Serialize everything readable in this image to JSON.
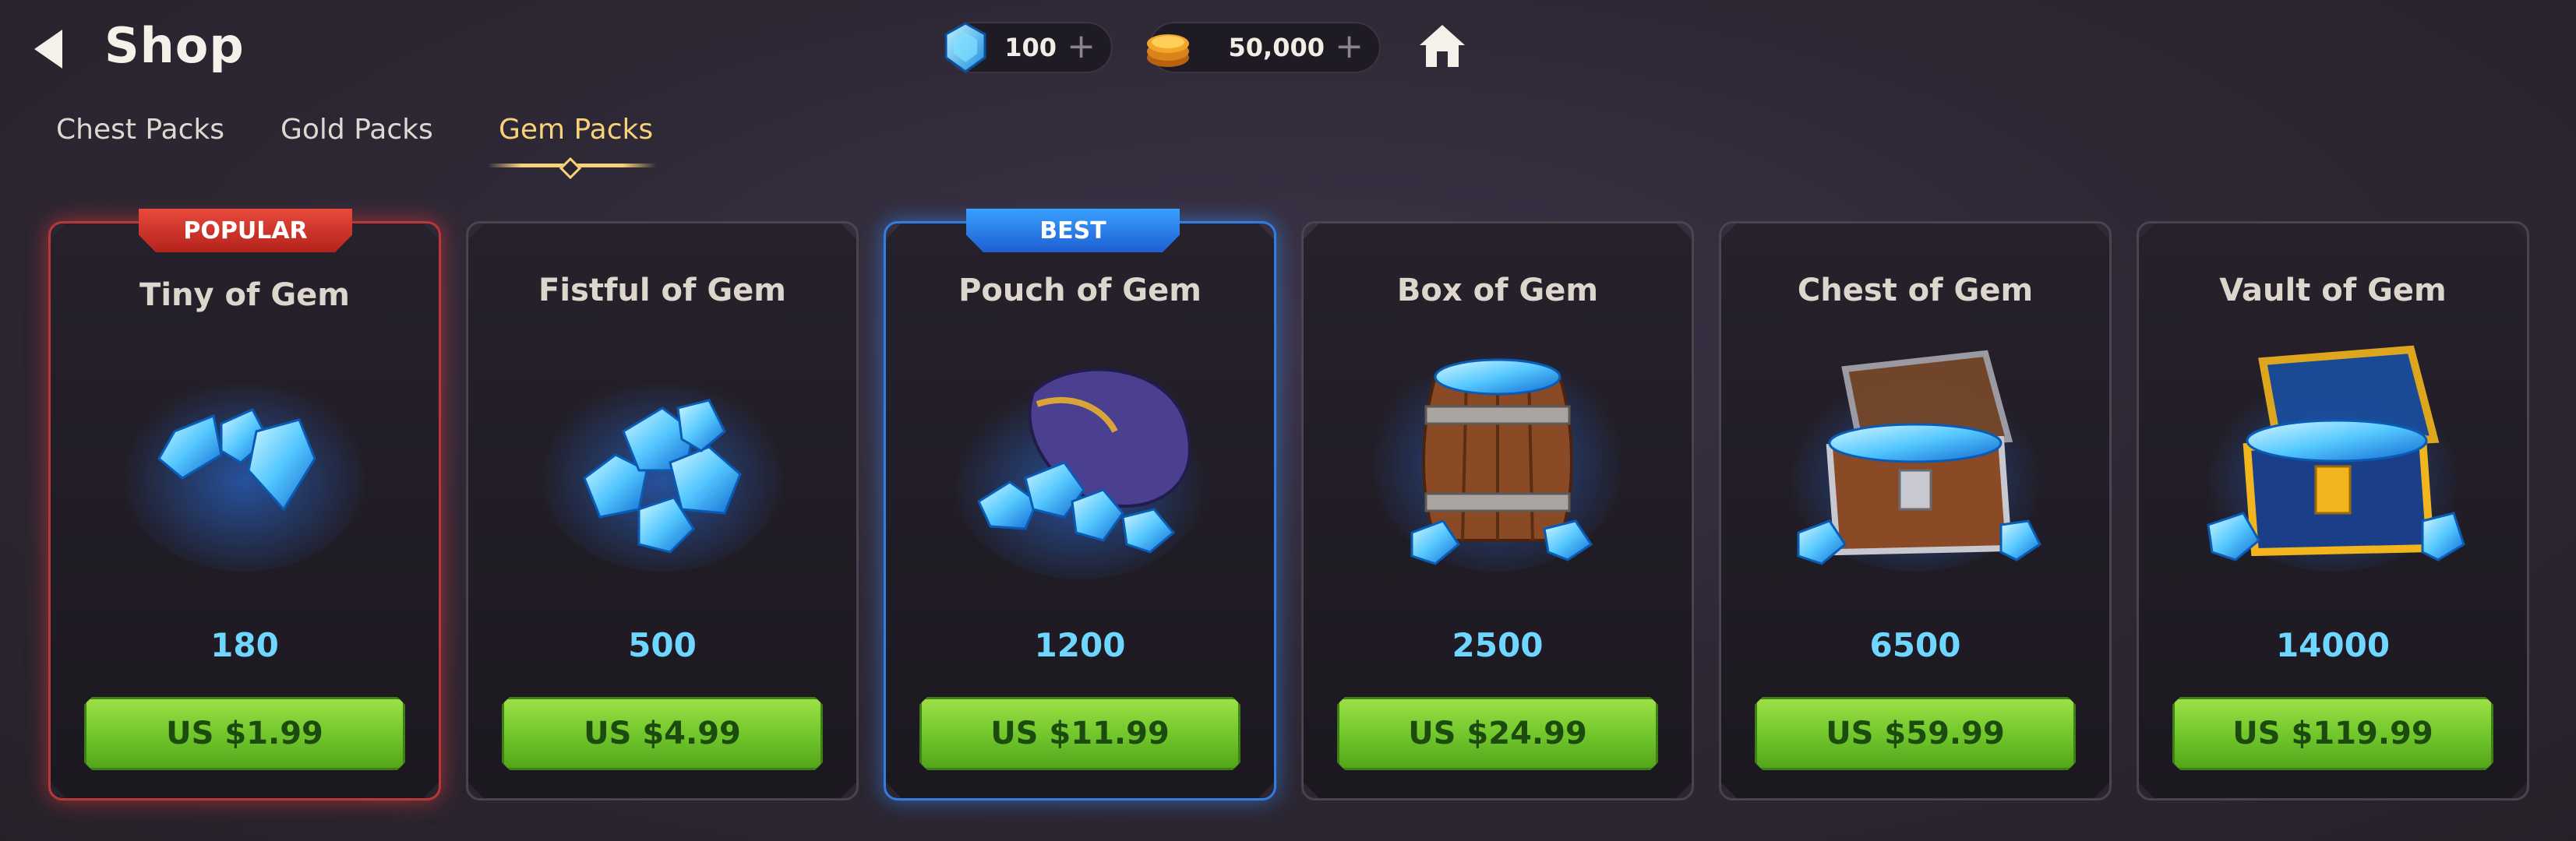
{
  "header": {
    "title": "Shop",
    "gems": "100",
    "gold": "50,000",
    "plus": "+"
  },
  "tabs": [
    "Chest Packs",
    "Gold Packs",
    "Gem Packs"
  ],
  "active_tab": "Gem Packs",
  "cards": [
    {
      "title": "Tiny of Gem",
      "amount": "180",
      "price": "US $1.99",
      "badge": "POPULAR"
    },
    {
      "title": "Fistful of Gem",
      "amount": "500",
      "price": "US $4.99",
      "badge": ""
    },
    {
      "title": "Pouch of Gem",
      "amount": "1200",
      "price": "US $11.99",
      "badge": "BEST"
    },
    {
      "title": "Box of Gem",
      "amount": "2500",
      "price": "US $24.99",
      "badge": ""
    },
    {
      "title": "Chest of Gem",
      "amount": "6500",
      "price": "US $59.99",
      "badge": ""
    },
    {
      "title": "Vault of Gem",
      "amount": "14000",
      "price": "US $119.99",
      "badge": ""
    }
  ],
  "icons": {
    "back": "back-arrow-icon",
    "gem": "gem-icon",
    "gold": "gold-coin-icon",
    "home": "home-icon"
  },
  "colors": {
    "accent_tab": "#f6d27a",
    "amount": "#6fd7ff",
    "buy_button": "#6fc52a",
    "badge_popular": "#d3342a",
    "badge_best": "#2b7fe8"
  }
}
